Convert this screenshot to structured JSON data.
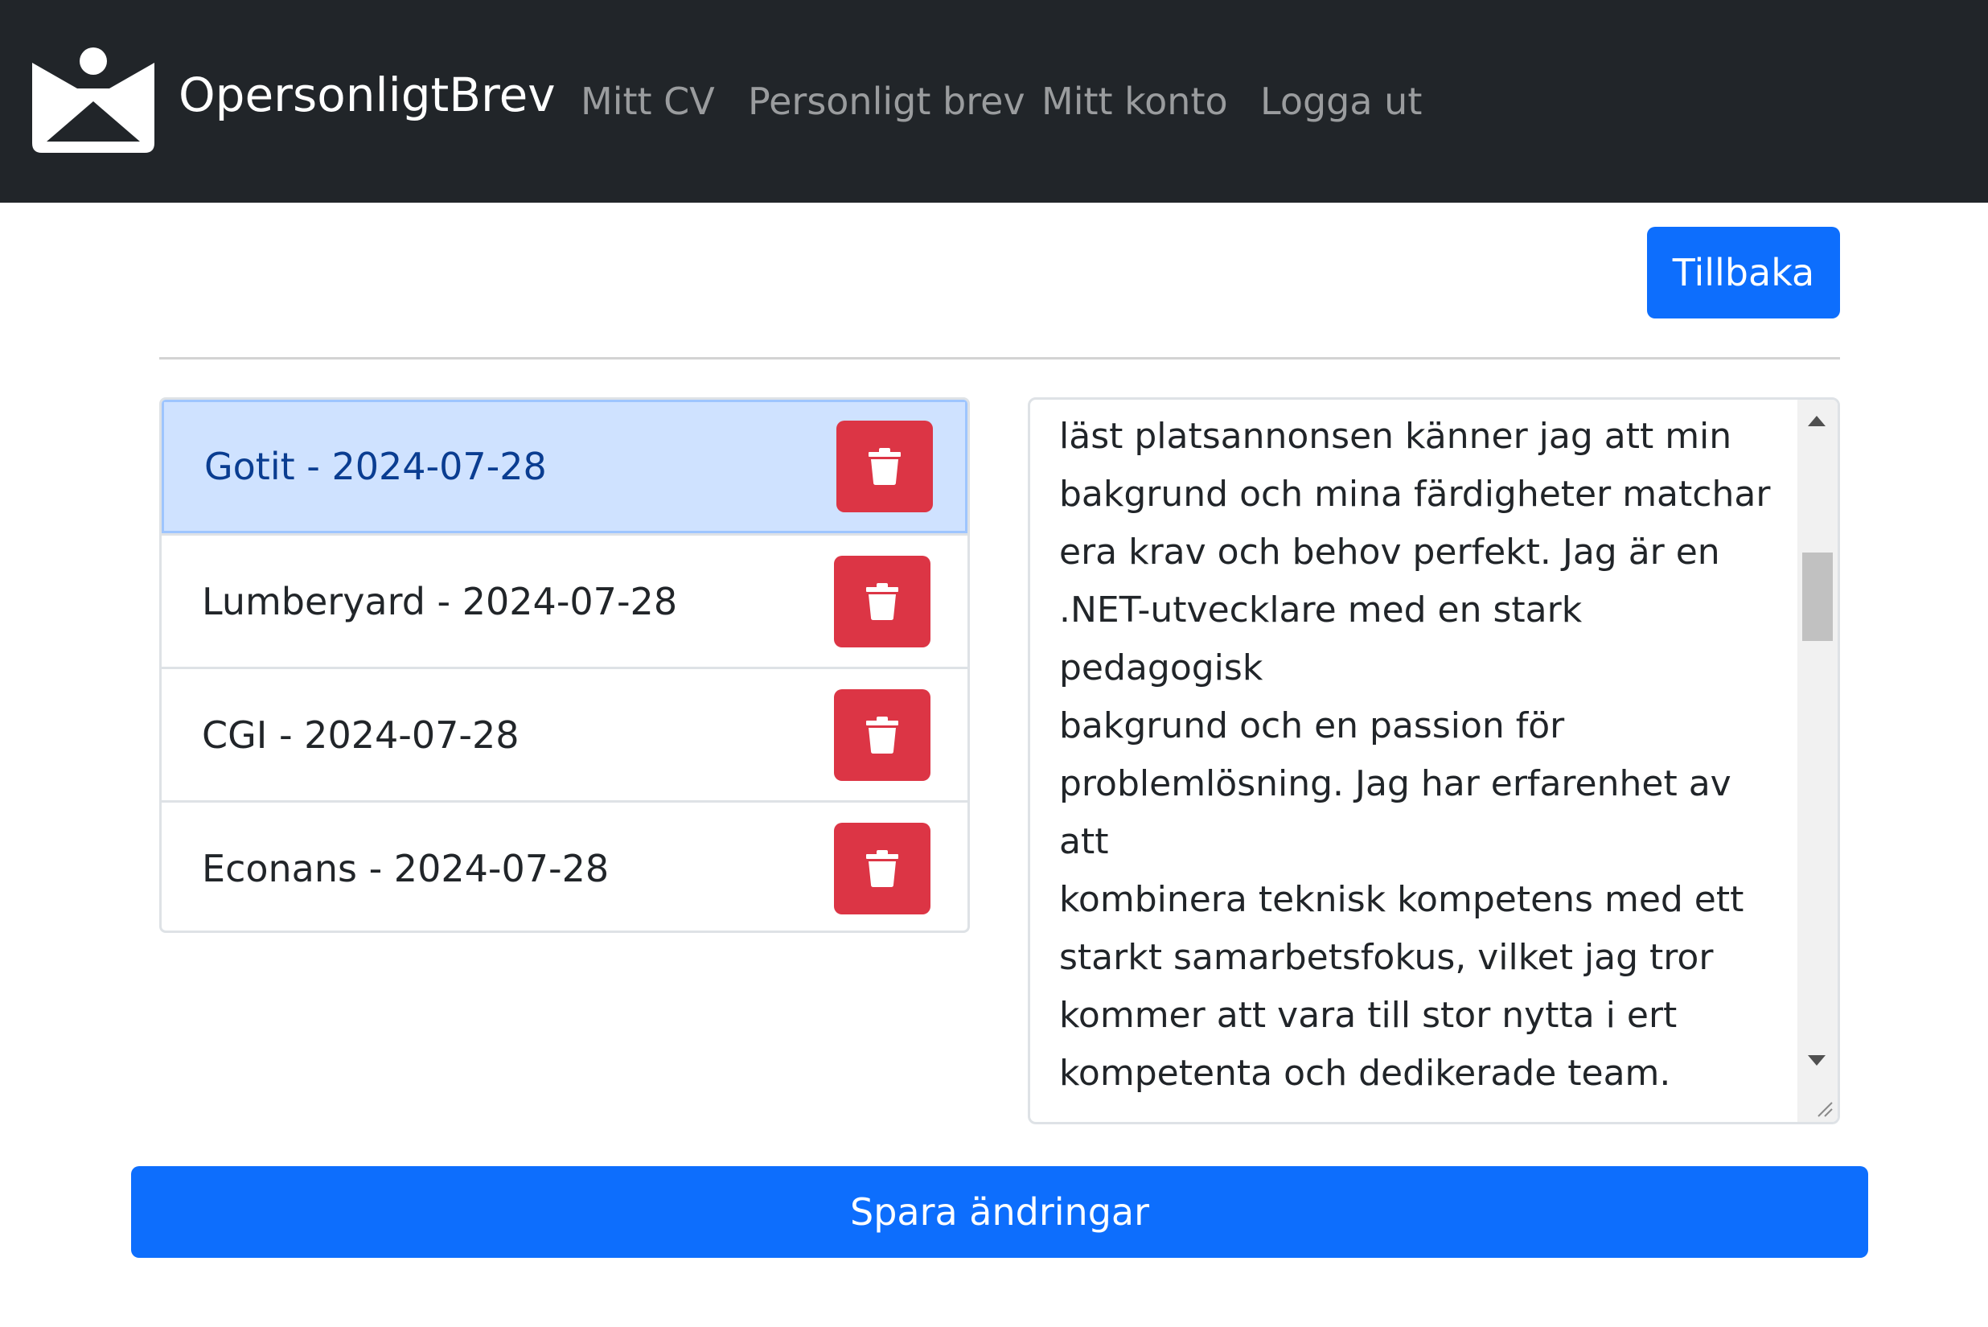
{
  "navbar": {
    "brand": "OpersonligtBrev",
    "links": [
      "Mitt CV",
      "Personligt brev",
      "Mitt konto",
      "Logga ut"
    ]
  },
  "actions": {
    "back_label": "Tillbaka",
    "save_label": "Spara ändringar"
  },
  "letters": [
    {
      "label": "Gotit - 2024-07-28",
      "active": true
    },
    {
      "label": "Lumberyard - 2024-07-28",
      "active": false
    },
    {
      "label": "CGI - 2024-07-28",
      "active": false
    },
    {
      "label": "Econans - 2024-07-28",
      "active": false
    }
  ],
  "editor": {
    "text": "läst platsannonsen känner jag att min\nbakgrund och mina färdigheter matchar\nera krav och behov perfekt. Jag är en\n.NET-utvecklare med en stark pedagogisk\nbakgrund och en passion för\nproblemlösning. Jag har erfarenhet av att\nkombinera teknisk kompetens med ett\nstarkt samarbetsfokus, vilket jag tror\nkommer att vara till stor nytta i ert\nkompetenta och dedikerade team.\n\nMin erfarenhet av .NET, C#, JavaScript\noch SQL, samt mina kunskaper i HTML"
  },
  "icons": {
    "brand": "mountain-person-logo",
    "delete": "trash-icon"
  },
  "colors": {
    "navbar": "#212529",
    "primary": "#0d6efd",
    "danger": "#dc3545",
    "active_item": "#cfe2ff"
  }
}
